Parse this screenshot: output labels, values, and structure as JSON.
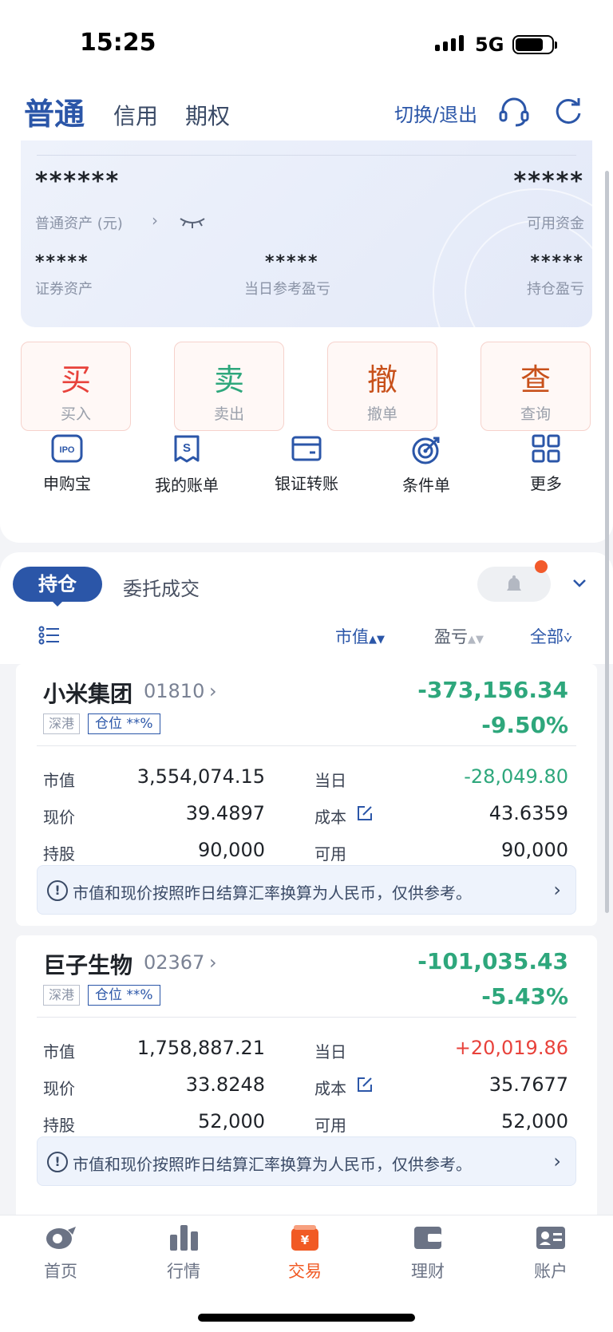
{
  "status_bar": {
    "time": "15:25",
    "network": "5G"
  },
  "header": {
    "tab_active": "普通",
    "tab_credit": "信用",
    "tab_options": "期权",
    "switch_exit": "切换/退出"
  },
  "assets": {
    "total_mask": "******",
    "available_mask": "*****",
    "total_label": "普通资产 (元)",
    "available_label": "可用资金",
    "securities_mask": "*****",
    "securities_label": "证券资产",
    "daily_pnl_mask": "*****",
    "daily_pnl_label": "当日参考盈亏",
    "holding_pnl_mask": "*****",
    "holding_pnl_label": "持仓盈亏"
  },
  "actions": [
    {
      "big": "买",
      "small": "买入",
      "color": "#e8423b"
    },
    {
      "big": "卖",
      "small": "卖出",
      "color": "#2ea77c"
    },
    {
      "big": "撤",
      "small": "撤单",
      "color": "#c8511b"
    },
    {
      "big": "查",
      "small": "查询",
      "color": "#c8511b"
    }
  ],
  "functions": [
    {
      "label": "申购宝",
      "icon": "ipo-icon"
    },
    {
      "label": "我的账单",
      "icon": "bill-icon"
    },
    {
      "label": "银证转账",
      "icon": "card-icon"
    },
    {
      "label": "条件单",
      "icon": "target-icon"
    },
    {
      "label": "更多",
      "icon": "grid-icon"
    }
  ],
  "positions": {
    "tab_holdings": "持仓",
    "tab_entrust": "委托成交",
    "sort_market_value": "市值",
    "sort_pnl": "盈亏",
    "filter_all": "全部"
  },
  "holdings": [
    {
      "name": "小米集团",
      "code": "01810",
      "pnl": "-373,156.34",
      "pnl_pct": "-9.50%",
      "market": "深港",
      "position": "仓位 **%",
      "market_value_label": "市值",
      "market_value": "3,554,074.15",
      "daily_label": "当日",
      "daily": "-28,049.80",
      "daily_color": "#2ea77c",
      "price_label": "现价",
      "price": "39.4897",
      "cost_label": "成本",
      "cost": "43.6359",
      "shares_label": "持股",
      "shares": "90,000",
      "available_label": "可用",
      "available": "90,000",
      "notice": "市值和现价按照昨日结算汇率换算为人民币，仅供参考。"
    },
    {
      "name": "巨子生物",
      "code": "02367",
      "pnl": "-101,035.43",
      "pnl_pct": "-5.43%",
      "market": "深港",
      "position": "仓位 **%",
      "market_value_label": "市值",
      "market_value": "1,758,887.21",
      "daily_label": "当日",
      "daily": "+20,019.86",
      "daily_color": "#e8423b",
      "price_label": "现价",
      "price": "33.8248",
      "cost_label": "成本",
      "cost": "35.7677",
      "shares_label": "持股",
      "shares": "52,000",
      "available_label": "可用",
      "available": "52,000",
      "notice": "市值和现价按照昨日结算汇率换算为人民币，仅供参考。"
    }
  ],
  "bottom_nav": [
    {
      "label": "首页",
      "icon": "home-icon"
    },
    {
      "label": "行情",
      "icon": "chart-icon"
    },
    {
      "label": "交易",
      "icon": "trade-icon",
      "active": true
    },
    {
      "label": "理财",
      "icon": "wallet-icon"
    },
    {
      "label": "账户",
      "icon": "account-icon"
    }
  ],
  "colors": {
    "brand": "#2b56a8",
    "down": "#2ea77c",
    "up": "#e8423b",
    "accent": "#f15a24"
  }
}
